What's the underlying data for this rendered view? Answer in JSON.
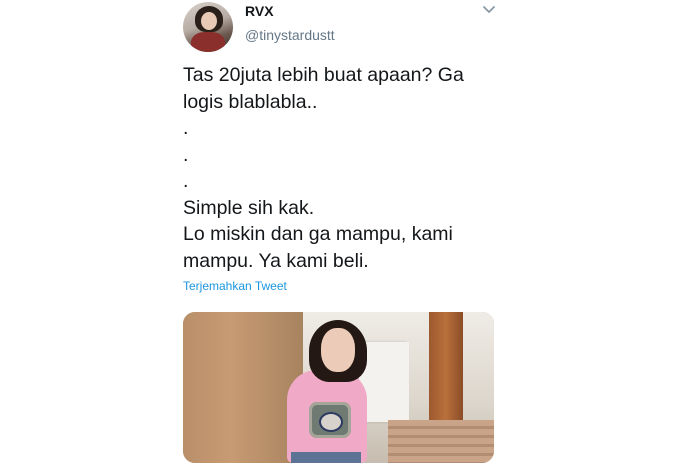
{
  "tweet": {
    "display_name": "RVX",
    "handle": "@tinystardustt",
    "text": "Tas 20juta lebih buat apaan? Ga logis blablabla..\n.\n.\n.\nSimple sih kak.\nLo miskin dan ga mampu, kami mampu. Ya kami beli.",
    "translate_label": "Terjemahkan Tweet",
    "menu_icon": "chevron-down-icon",
    "colors": {
      "name": "#14171a",
      "handle": "#657786",
      "link": "#1b95e0"
    }
  }
}
